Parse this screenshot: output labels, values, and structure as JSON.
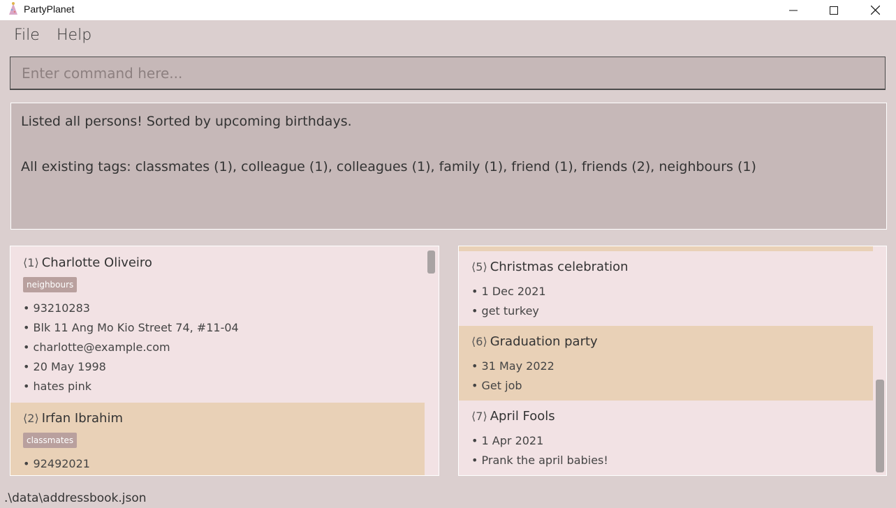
{
  "window": {
    "title": "PartyPlanet",
    "icon": "party-hat-icon"
  },
  "menu": {
    "file": "File",
    "help": "Help"
  },
  "command": {
    "placeholder": "Enter command here...",
    "value": ""
  },
  "result": {
    "line1": "Listed all persons! Sorted by upcoming birthdays.",
    "line2": "All existing tags: classmates (1), colleague (1), colleagues (1), family (1), friend (1), friends (2), neighbours (1)"
  },
  "persons": [
    {
      "index": "1",
      "name": "Charlotte Oliveiro",
      "tag": "neighbours",
      "phone": "93210283",
      "address": "Blk 11 Ang Mo Kio Street 74, #11-04",
      "email": "charlotte@example.com",
      "birthday": "20 May 1998",
      "remark": "hates pink"
    },
    {
      "index": "2",
      "name": "Irfan Ibrahim",
      "tag": "classmates",
      "phone": "92492021"
    }
  ],
  "events": [
    {
      "index": "5",
      "name": "Christmas celebration",
      "date": "1 Dec 2021",
      "detail": "get turkey"
    },
    {
      "index": "6",
      "name": "Graduation party",
      "date": "31 May 2022",
      "detail": "Get job"
    },
    {
      "index": "7",
      "name": "April Fools",
      "date": "1 Apr 2021",
      "detail": "Prank the april babies!"
    }
  ],
  "status": {
    "path": ".\\data\\addressbook.json"
  },
  "colors": {
    "background": "#dbcfcf",
    "card": "#f2e2e4",
    "card_alt": "#e9d1b7",
    "tag": "#b9a09e"
  }
}
